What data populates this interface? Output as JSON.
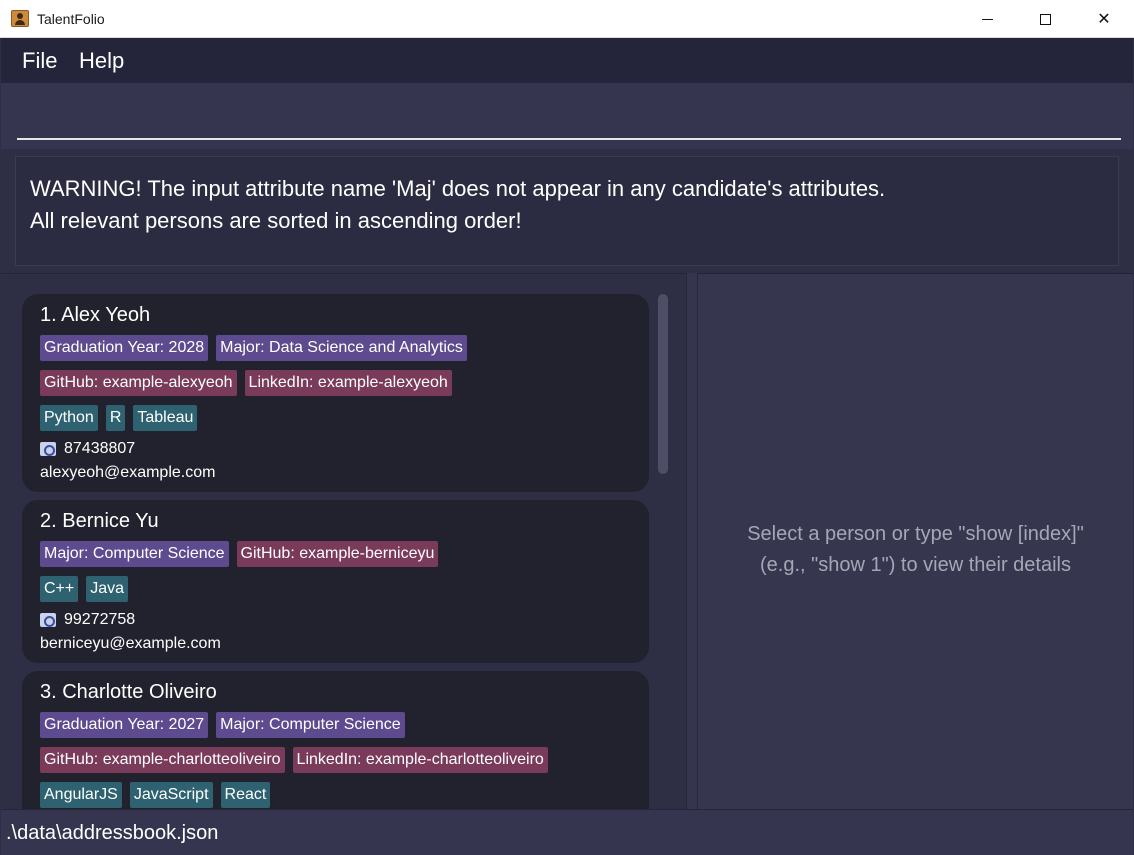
{
  "window": {
    "title": "TalentFolio",
    "minimize": "—",
    "maximize": "☐",
    "close": "✕"
  },
  "menu": {
    "file": "File",
    "help": "Help"
  },
  "command": {
    "value": "",
    "placeholder": ""
  },
  "result": {
    "line1": "WARNING! The input attribute name 'Maj' does not appear in any candidate's attributes.",
    "line2": "All relevant persons are sorted in ascending order!"
  },
  "persons": [
    {
      "name": "1. Alex Yeoh",
      "tag_rows": [
        [
          {
            "text": "Graduation Year: 2028",
            "color": "purple"
          },
          {
            "text": "Major: Data Science and Analytics",
            "color": "purple"
          }
        ],
        [
          {
            "text": "GitHub: example-alexyeoh",
            "color": "pink"
          },
          {
            "text": "LinkedIn: example-alexyeoh",
            "color": "pink"
          }
        ],
        [
          {
            "text": "Python",
            "color": "teal"
          },
          {
            "text": "R",
            "color": "teal"
          },
          {
            "text": "Tableau",
            "color": "teal"
          }
        ]
      ],
      "phone": "87438807",
      "email": "alexyeoh@example.com"
    },
    {
      "name": "2. Bernice Yu",
      "tag_rows": [
        [
          {
            "text": "Major: Computer Science",
            "color": "purple"
          },
          {
            "text": "GitHub: example-berniceyu",
            "color": "pink"
          }
        ],
        [
          {
            "text": "C++",
            "color": "teal"
          },
          {
            "text": "Java",
            "color": "teal"
          }
        ]
      ],
      "phone": "99272758",
      "email": "berniceyu@example.com"
    },
    {
      "name": "3. Charlotte Oliveiro",
      "tag_rows": [
        [
          {
            "text": "Graduation Year: 2027",
            "color": "purple"
          },
          {
            "text": "Major: Computer Science",
            "color": "purple"
          }
        ],
        [
          {
            "text": "GitHub: example-charlotteoliveiro",
            "color": "pink"
          },
          {
            "text": "LinkedIn: example-charlotteoliveiro",
            "color": "pink"
          }
        ],
        [
          {
            "text": "AngularJS",
            "color": "teal"
          },
          {
            "text": "JavaScript",
            "color": "teal"
          },
          {
            "text": "React",
            "color": "teal"
          }
        ]
      ],
      "phone": "",
      "email": ""
    }
  ],
  "detail": {
    "line1": "Select a person or type \"show [index]\"",
    "line2": "(e.g., \"show 1\") to view their details"
  },
  "status": {
    "path": ".\\data\\addressbook.json"
  },
  "colors": {
    "tag_purple": "#5e4a8e",
    "tag_pink": "#7a3a5a",
    "tag_teal": "#2e6270",
    "background": "#2e2e44"
  }
}
